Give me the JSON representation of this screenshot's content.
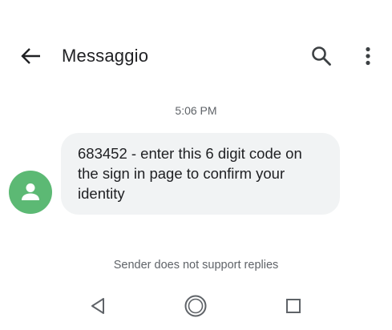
{
  "header": {
    "title": "Messaggio",
    "back_icon": "arrow-back-icon",
    "search_icon": "search-icon",
    "more_icon": "more-vert-icon"
  },
  "conversation": {
    "timestamp": "5:06 PM",
    "messages": [
      {
        "text": "683452 - enter this 6 digit code on the sign in page to confirm your identity",
        "direction": "incoming"
      }
    ],
    "avatar_icon": "person-icon",
    "avatar_color": "#5cb974",
    "bubble_color": "#f1f3f4"
  },
  "footer": {
    "note": "Sender does not support replies"
  },
  "navbar": {
    "back_icon": "nav-back-triangle-icon",
    "home_icon": "nav-home-circle-icon",
    "recents_icon": "nav-recents-square-icon"
  }
}
